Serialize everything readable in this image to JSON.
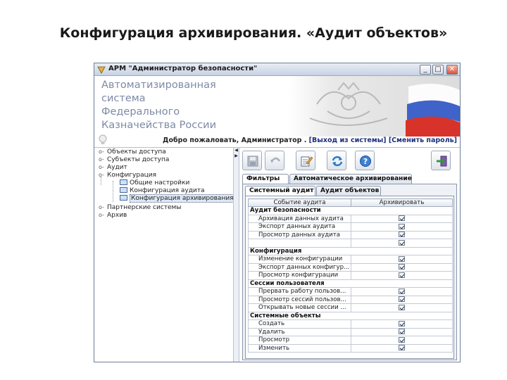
{
  "slide": {
    "title": "Конфигурация архивирования. «Аудит объектов»"
  },
  "window": {
    "title": "АРМ \"Администратор безопасности\"",
    "controls": {
      "minimize": "_",
      "maximize": "□",
      "close": "✕"
    }
  },
  "banner": {
    "lines": [
      "Автоматизированная",
      "система",
      "Федерального",
      "Казначейства России"
    ]
  },
  "welcome": {
    "greeting": "Добро пожаловать, Администратор  .",
    "logout": "[Выход из системы]",
    "change_password": "[Сменить пароль]"
  },
  "tree": {
    "items": [
      {
        "label": "Объекты доступа"
      },
      {
        "label": "Субъекты доступа"
      },
      {
        "label": "Аудит"
      },
      {
        "label": "Конфигурация"
      },
      {
        "label": "Общие настройки"
      },
      {
        "label": "Конфигурация аудита"
      },
      {
        "label": "Конфигурация архивирования"
      },
      {
        "label": "Партнерские системы"
      },
      {
        "label": "Архив"
      }
    ]
  },
  "toolbar": {
    "buttons": [
      {
        "icon": "save-icon"
      },
      {
        "icon": "undo-icon"
      },
      {
        "icon": "edit-icon"
      },
      {
        "icon": "refresh-icon"
      },
      {
        "icon": "help-icon"
      },
      {
        "icon": "exit-icon"
      }
    ]
  },
  "tabs": {
    "outer": [
      {
        "label": "Фильтры"
      },
      {
        "label": "Автоматическое архивирование"
      }
    ],
    "inner": [
      {
        "label": "Системный аудит"
      },
      {
        "label": "Аудит объектов"
      }
    ]
  },
  "grid": {
    "columns": [
      "Событие аудита",
      "Архивировать"
    ],
    "groups": [
      {
        "name": "Аудит безопасности",
        "rows": [
          "Архивация данных аудита",
          "Экспорт данных аудита",
          "Просмотр данных аудита",
          ""
        ]
      },
      {
        "name": "Конфигурация",
        "rows": [
          "Изменение конфигурации",
          "Экспорт данных конфигур...",
          "Просмотр конфигурации"
        ]
      },
      {
        "name": "Сессии пользователя",
        "rows": [
          "Прервать работу пользов...",
          "Просмотр сессий пользов...",
          "Открывать новые сессии ..."
        ]
      },
      {
        "name": "Системные объекты",
        "rows": [
          "Создать",
          "Удалить",
          "Просмотр",
          "Изменить"
        ]
      }
    ],
    "checked": true
  },
  "colors": {
    "banner_text": "#7d8aa6",
    "titlebar": "#c8d2e3",
    "tab_border": "#8a97ad"
  }
}
